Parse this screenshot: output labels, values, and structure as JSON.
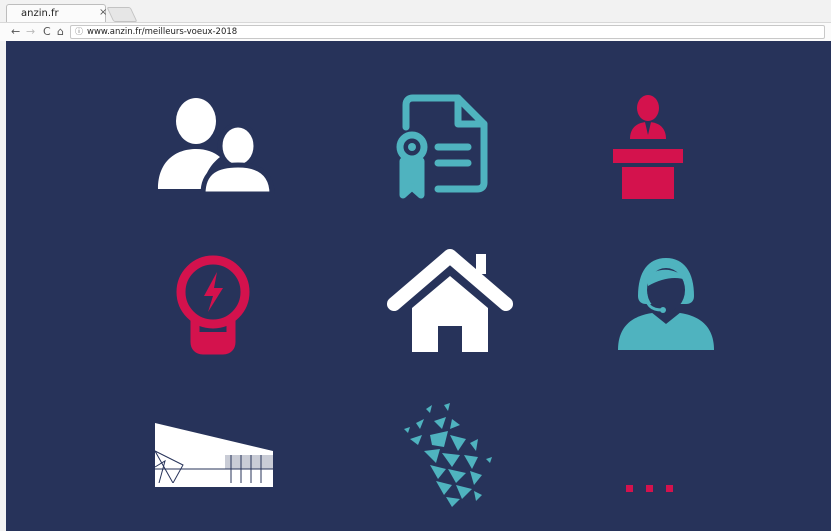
{
  "browser": {
    "tab_title": "anzin.fr",
    "tab_close": "×",
    "back_glyph": "←",
    "forward_glyph": "→",
    "reload_glyph": "C",
    "home_glyph": "⌂",
    "info_glyph": "ⓘ",
    "url": "www.anzin.fr/meilleurs-voeux-2018"
  },
  "page": {
    "background_color": "#27335a",
    "icons": [
      {
        "name": "people-icon",
        "color": "#ffffff"
      },
      {
        "name": "certificate-document-icon",
        "color": "#4fb3bf"
      },
      {
        "name": "speaker-podium-icon",
        "color": "#d4124d"
      },
      {
        "name": "lightbulb-energy-icon",
        "color": "#d4124d"
      },
      {
        "name": "house-icon",
        "color": "#ffffff"
      },
      {
        "name": "support-agent-icon",
        "color": "#4fb3bf"
      },
      {
        "name": "building-icon",
        "color": "#ffffff"
      },
      {
        "name": "shattered-face-icon",
        "color": "#4fb3bf"
      },
      {
        "name": "more-dots-icon",
        "color": "#d4124d"
      }
    ]
  }
}
